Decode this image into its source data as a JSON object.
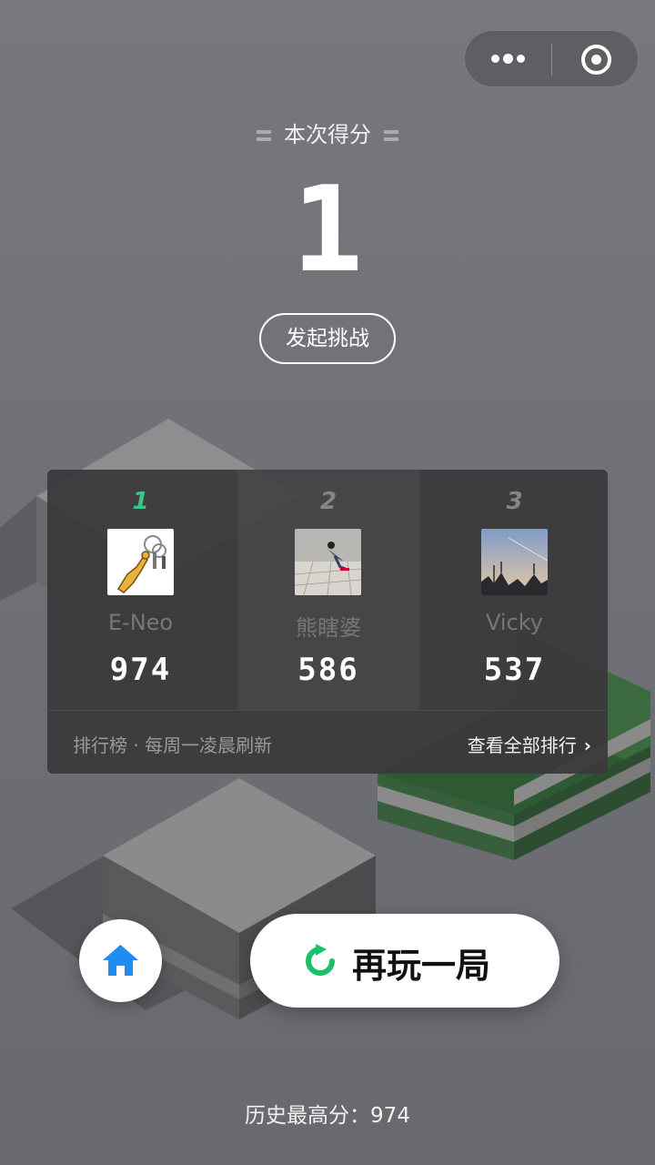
{
  "capsule": {
    "more_icon": "more-dots-icon",
    "close_icon": "target-close-icon"
  },
  "score": {
    "title": "本次得分",
    "value": "1"
  },
  "challenge": {
    "label": "发起挑战"
  },
  "leaderboard": {
    "players": [
      {
        "rank": "1",
        "name": "E-Neo",
        "score": "974"
      },
      {
        "rank": "2",
        "name": "熊瞎婆",
        "score": "586"
      },
      {
        "rank": "3",
        "name": "Vicky",
        "score": "537"
      }
    ],
    "note": "排行榜 · 每周一凌晨刷新",
    "view_all": "查看全部排行"
  },
  "buttons": {
    "home_icon": "home-icon",
    "replay_label": "再玩一局",
    "replay_icon": "refresh-icon"
  },
  "best": {
    "text": "历史最高分：974"
  },
  "colors": {
    "accent_green": "#3cc489",
    "home_blue": "#1e8cf0",
    "replay_green": "#1dbf6a"
  }
}
